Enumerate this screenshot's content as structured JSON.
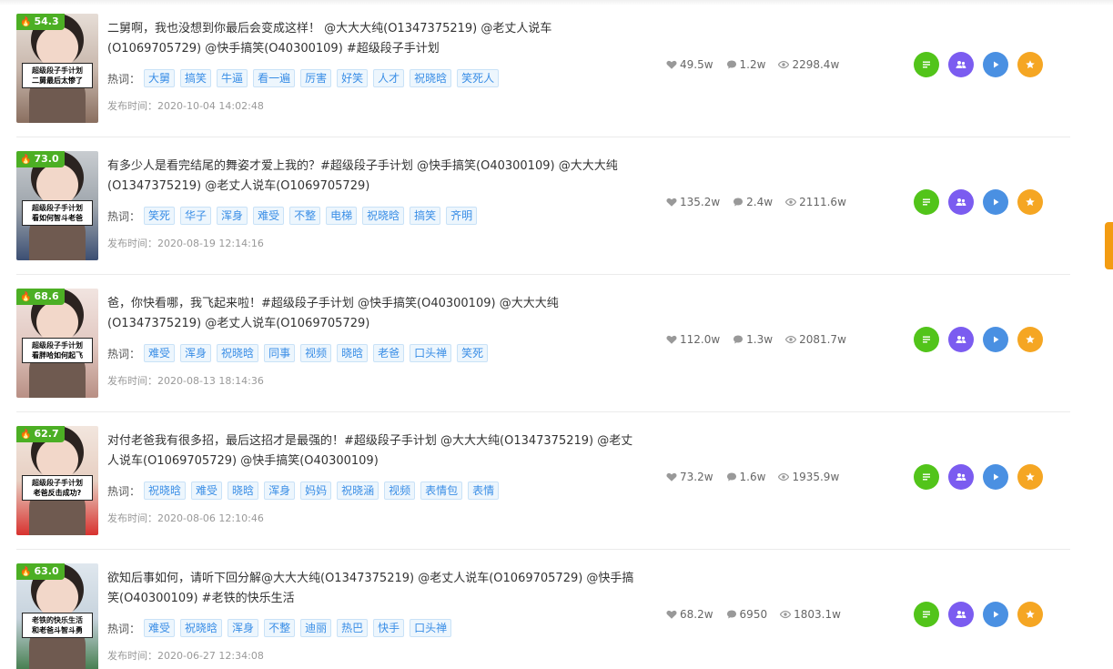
{
  "colors": {
    "score_bg": "#4caf24",
    "tag_text": "#3a8ee6",
    "btn_detail": "#52c41a",
    "btn_fans": "#7b5cf0",
    "btn_play": "#4a90e2",
    "btn_star": "#f5a623",
    "scroll_accent": "#f39c12"
  },
  "labels": {
    "tags_label": "热词：",
    "date_prefix": "发布时间："
  },
  "icons": [
    "fire-icon",
    "heart-icon",
    "comment-icon",
    "eye-icon",
    "list-icon",
    "users-icon",
    "play-icon",
    "star-icon"
  ],
  "rows": [
    {
      "score": "54.3",
      "caption": [
        "超级段子手计划",
        "二舅最后太惨了"
      ],
      "title": "二舅啊，我也没想到你最后会变成这样！ @大大大纯(O1347375219) @老丈人说车(O1069705729) @快手搞笑(O40300109) #超级段子手计划",
      "tags": [
        "大舅",
        "搞笑",
        "牛逼",
        "看一遍",
        "厉害",
        "好笑",
        "人才",
        "祝晓晗",
        "笑死人"
      ],
      "date": "2020-10-04 14:02:48",
      "likes": "49.5w",
      "comments": "1.2w",
      "views": "2298.4w"
    },
    {
      "score": "73.0",
      "caption": [
        "超级段子手计划",
        "看如何智斗老爸"
      ],
      "title": "有多少人是看完结尾的舞姿才爱上我的？#超级段子手计划 @快手搞笑(O40300109) @大大大纯(O1347375219) @老丈人说车(O1069705729)",
      "tags": [
        "笑死",
        "华子",
        "浑身",
        "难受",
        "不整",
        "电梯",
        "祝晓晗",
        "搞笑",
        "齐明"
      ],
      "date": "2020-08-19 12:14:16",
      "likes": "135.2w",
      "comments": "2.4w",
      "views": "2111.6w"
    },
    {
      "score": "68.6",
      "caption": [
        "超级段子手计划",
        "看胖哈如何起飞"
      ],
      "title": "爸，你快看哪，我飞起来啦！#超级段子手计划 @快手搞笑(O40300109) @大大大纯(O1347375219) @老丈人说车(O1069705729)",
      "tags": [
        "难受",
        "浑身",
        "祝晓晗",
        "同事",
        "视频",
        "晓晗",
        "老爸",
        "口头禅",
        "笑死"
      ],
      "date": "2020-08-13 18:14:36",
      "likes": "112.0w",
      "comments": "1.3w",
      "views": "2081.7w"
    },
    {
      "score": "62.7",
      "caption": [
        "超级段子手计划",
        "老爸反击成功?"
      ],
      "title": "对付老爸我有很多招，最后这招才是最强的！#超级段子手计划 @大大大纯(O1347375219) @老丈人说车(O1069705729) @快手搞笑(O40300109)",
      "tags": [
        "祝晓晗",
        "难受",
        "晓晗",
        "浑身",
        "妈妈",
        "祝晓涵",
        "视频",
        "表情包",
        "表情"
      ],
      "date": "2020-08-06 12:10:46",
      "likes": "73.2w",
      "comments": "1.6w",
      "views": "1935.9w"
    },
    {
      "score": "63.0",
      "caption": [
        "老铁的快乐生活",
        "和老爸斗智斗勇"
      ],
      "title": "欲知后事如何，请听下回分解@大大大纯(O1347375219) @老丈人说车(O1069705729) @快手搞笑(O40300109) #老铁的快乐生活",
      "tags": [
        "难受",
        "祝晓晗",
        "浑身",
        "不整",
        "迪丽",
        "热巴",
        "快手",
        "口头禅"
      ],
      "date": "2020-06-27 12:34:08",
      "likes": "68.2w",
      "comments": "6950",
      "views": "1803.1w"
    }
  ]
}
